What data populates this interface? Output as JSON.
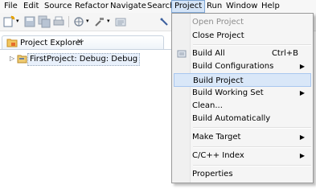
{
  "menubar": {
    "items": [
      "File",
      "Edit",
      "Source",
      "Refactor",
      "Navigate",
      "Search",
      "Project",
      "Run",
      "Window",
      "Help"
    ],
    "active": "Project"
  },
  "project_explorer": {
    "title": "Project Explorer",
    "close_glyph": "✕",
    "tree": [
      {
        "label": "FirstProject: Debug: Debug",
        "expand_glyph": "▷"
      }
    ]
  },
  "project_menu": {
    "open_project": "Open Project",
    "close_project": "Close Project",
    "build_all": "Build All",
    "build_all_shortcut": "Ctrl+B",
    "build_configurations": "Build Configurations",
    "build_project": "Build Project",
    "build_working_set": "Build Working Set",
    "clean": "Clean...",
    "build_automatically": "Build Automatically",
    "make_target": "Make Target",
    "cpp_index": "C/C++ Index",
    "properties": "Properties",
    "submenu_arrow": "▶"
  },
  "colors": {
    "menu_highlight": "#d9e7f8",
    "active_menu_border": "#7ea6d4",
    "menu_background": "#f5f5f5"
  },
  "icons": [
    "new-icon",
    "save-icon",
    "save-all-icon",
    "print-icon",
    "debug-icon",
    "build-icon",
    "build-all-icon",
    "folder-project-icon"
  ]
}
